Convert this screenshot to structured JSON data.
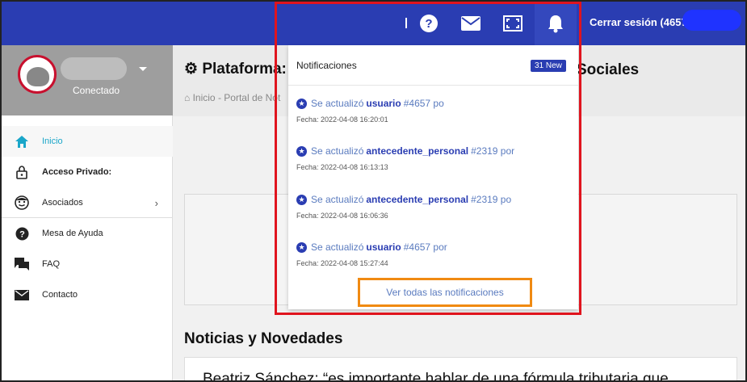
{
  "topbar": {
    "logout_label": "Cerrar sesión (4657,",
    "accent": "#2a3db2"
  },
  "sidebar": {
    "status": "Conectado",
    "items": [
      {
        "label": "Inicio",
        "icon": "home-icon"
      },
      {
        "label": "Acceso Privado:",
        "icon": "lock-icon"
      },
      {
        "label": "Asociados",
        "icon": "face-icon"
      },
      {
        "label": "Mesa de Ayuda",
        "icon": "help-icon"
      },
      {
        "label": "FAQ",
        "icon": "chat-icon"
      },
      {
        "label": "Contacto",
        "icon": "mail-icon"
      }
    ]
  },
  "main": {
    "title": "Plataforma:",
    "title_right": "Sociales",
    "breadcrumb": "Inicio - Portal de Not",
    "news_title": "Noticias y Novedades",
    "news_text": "Beatriz Sánchez: “es importante hablar de una fórmula tributaria que"
  },
  "notifications": {
    "title": "Notificaciones",
    "badge": "31 New",
    "items": [
      {
        "prefix": "Se actualizó",
        "entity": "usuario",
        "suffix": "#4657 po",
        "date": "Fecha: 2022-04-08 16:20:01"
      },
      {
        "prefix": "Se actualizó",
        "entity": "antecedente_personal",
        "suffix": "#2319 por",
        "date": "Fecha: 2022-04-08 16:13:13"
      },
      {
        "prefix": "Se actualizó",
        "entity": "antecedente_personal",
        "suffix": "#2319 po",
        "date": "Fecha: 2022-04-08 16:06:36"
      },
      {
        "prefix": "Se actualizó",
        "entity": "usuario",
        "suffix": "#4657 por",
        "date": "Fecha: 2022-04-08 15:27:44"
      }
    ],
    "see_all": "Ver todas las notificaciones"
  }
}
